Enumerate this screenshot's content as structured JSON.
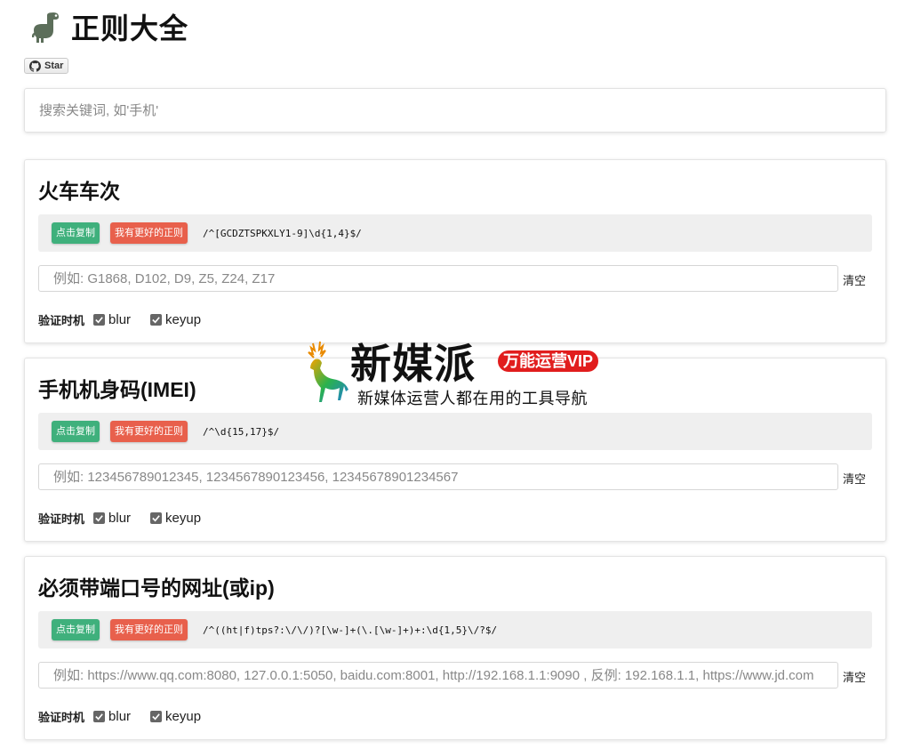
{
  "header": {
    "title": "正则大全",
    "star_label": "Star"
  },
  "search": {
    "placeholder": "搜索关键词, 如'手机'"
  },
  "cards": [
    {
      "title": "火车车次",
      "copy_label": "点击复制",
      "better_label": "我有更好的正则",
      "regex": "/^[GCDZTSPKXLY1-9]\\d{1,4}$/",
      "placeholder": "例如: G1868, D102, D9, Z5, Z24, Z17",
      "clear_label": "清空",
      "validate_label": "验证时机",
      "options": [
        "blur",
        "keyup"
      ]
    },
    {
      "title": "手机机身码(IMEI)",
      "copy_label": "点击复制",
      "better_label": "我有更好的正则",
      "regex": "/^\\d{15,17}$/",
      "placeholder": "例如: 123456789012345, 1234567890123456, 12345678901234567",
      "clear_label": "清空",
      "validate_label": "验证时机",
      "options": [
        "blur",
        "keyup"
      ]
    },
    {
      "title": "必须带端口号的网址(或ip)",
      "copy_label": "点击复制",
      "better_label": "我有更好的正则",
      "regex": "/^((ht|f)tps?:\\/\\/)?[\\w-]+(\\.[\\w-]+)+:\\d{1,5}\\/?$/",
      "placeholder": "例如: https://www.qq.com:8080, 127.0.0.1:5050, baidu.com:8001, http://192.168.1.1:9090 , 反例: 192.168.1.1, https://www.jd.com",
      "clear_label": "清空",
      "validate_label": "验证时机",
      "options": [
        "blur",
        "keyup"
      ]
    }
  ],
  "watermark": {
    "title": "新媒派",
    "badge": "万能运营VIP",
    "subtitle": "新媒体运营人都在用的工具导航"
  },
  "colors": {
    "copy_button": "#3fb07c",
    "better_button": "#e8604c",
    "badge": "#e11d1d"
  }
}
